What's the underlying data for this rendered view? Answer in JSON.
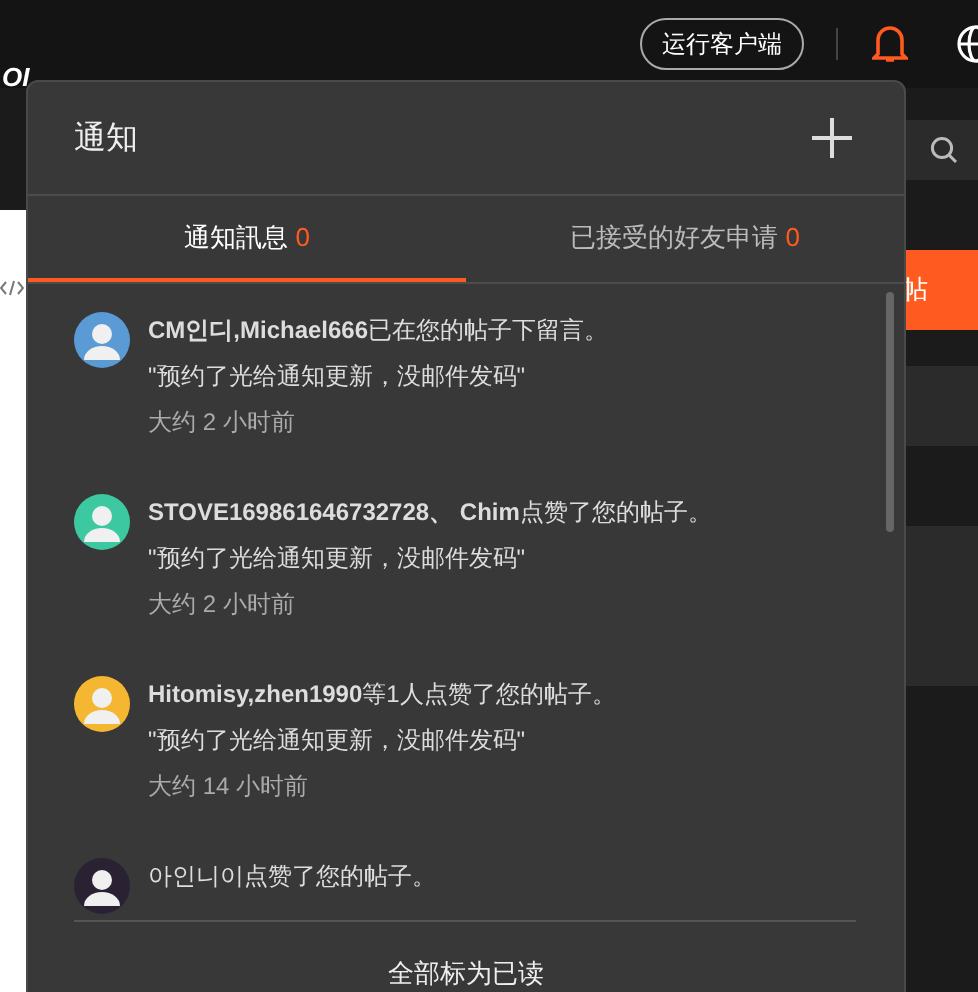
{
  "top_bar": {
    "client_button": "运行客户端",
    "logo_fragment": "OI"
  },
  "backdrop": {
    "post_button": "帖"
  },
  "notifications": {
    "title": "通知",
    "tabs": [
      {
        "label": "通知訊息",
        "count": "0",
        "selected": true
      },
      {
        "label": "已接受的好友申请",
        "count": "0",
        "selected": false
      }
    ],
    "items": [
      {
        "title": "**CM인디,Michael666**已在您的帖子下留言。",
        "quote": "\"预约了光给通知更新，没邮件发码\"",
        "time": "大约 2 小时前",
        "color": "#5b9bd5"
      },
      {
        "title": "**STOVE169861646732728、 Chim**点赞了您的帖子。",
        "quote": "\"预约了光给通知更新，没邮件发码\"",
        "time": "大约 2 小时前",
        "color": "#3cc8a0"
      },
      {
        "title": "**Hitomisy,zhen1990**等1人点赞了您的帖子。",
        "quote": "\"预约了光给通知更新，没邮件发码\"",
        "time": "大约 14 小时前",
        "color": "#f5b731"
      },
      {
        "title": "아인니이点赞了您的帖子。",
        "color": "#2a2233"
      }
    ],
    "mark_all_read": "全部标为已读"
  }
}
